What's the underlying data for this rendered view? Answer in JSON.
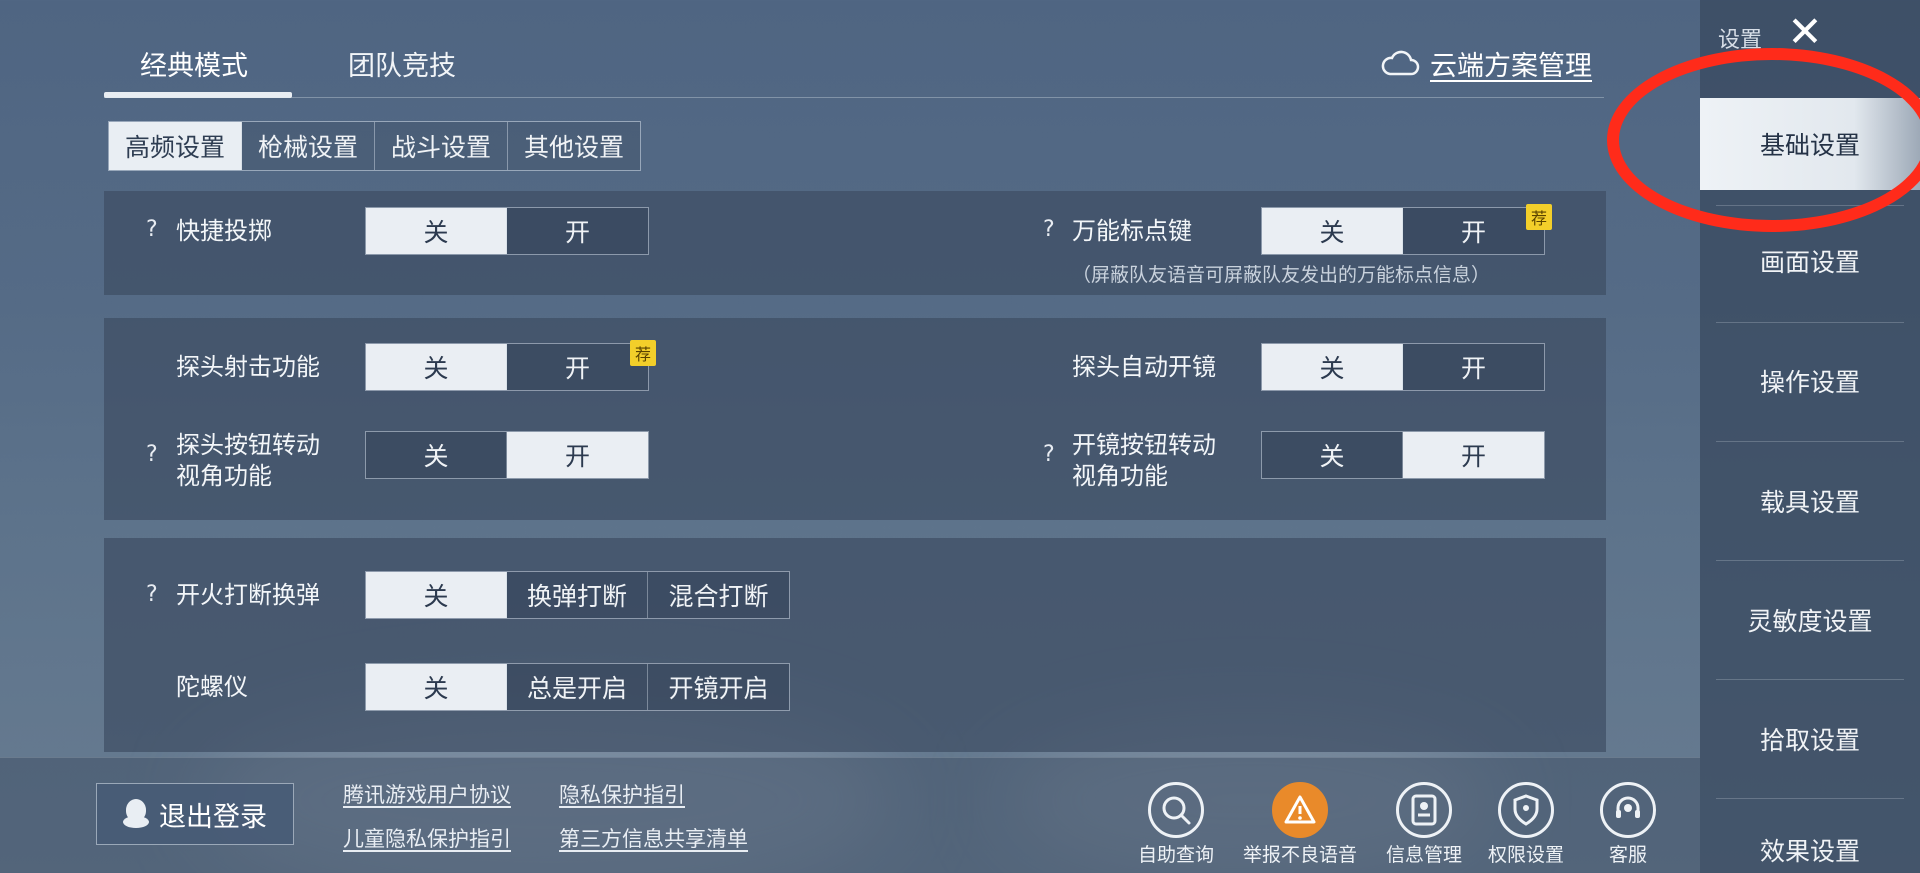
{
  "top_tabs": [
    "经典模式",
    "团队竞技"
  ],
  "cloud": {
    "label": "云端方案管理"
  },
  "sub_tabs": [
    "高频设置",
    "枪械设置",
    "战斗设置",
    "其他设置"
  ],
  "rec_badge": "荐",
  "settings": {
    "quick_throw": {
      "label": "快捷投掷",
      "options": [
        "关",
        "开"
      ],
      "selected": "关"
    },
    "universal_mark": {
      "label": "万能标点键",
      "options": [
        "关",
        "开"
      ],
      "selected": "关",
      "note": "（屏蔽队友语音可屏蔽队友发出的万能标点信息）"
    },
    "peek_shoot": {
      "label": "探头射击功能",
      "options": [
        "关",
        "开"
      ],
      "selected": "关"
    },
    "peek_auto_scope": {
      "label": "探头自动开镜",
      "options": [
        "关",
        "开"
      ],
      "selected": "关"
    },
    "peek_btn_rotate": {
      "label_line1": "探头按钮转动",
      "label_line2": "视角功能",
      "options": [
        "关",
        "开"
      ],
      "selected": "开"
    },
    "scope_btn_rotate": {
      "label_line1": "开镜按钮转动",
      "label_line2": "视角功能",
      "options": [
        "关",
        "开"
      ],
      "selected": "开"
    },
    "fire_interrupt": {
      "label": "开火打断换弹",
      "options": [
        "关",
        "换弹打断",
        "混合打断"
      ],
      "selected": "关"
    },
    "gyro": {
      "label": "陀螺仪",
      "options": [
        "关",
        "总是开启",
        "开镜开启"
      ],
      "selected": "关"
    }
  },
  "help_mark": "?",
  "sidebar": {
    "title": "设置",
    "close": "✕",
    "items": [
      "基础设置",
      "画面设置",
      "操作设置",
      "载具设置",
      "灵敏度设置",
      "拾取设置",
      "效果设置"
    ],
    "active": "基础设置"
  },
  "bottom": {
    "logout": "退出登录",
    "links": [
      "腾讯游戏用户协议",
      "隐私保护指引",
      "儿童隐私保护指引",
      "第三方信息共享清单"
    ],
    "icons": [
      {
        "label": "自助查询",
        "icon": "search-icon"
      },
      {
        "label": "举报不良语音",
        "icon": "warning-icon"
      },
      {
        "label": "信息管理",
        "icon": "id-card-icon"
      },
      {
        "label": "权限设置",
        "icon": "shield-icon"
      },
      {
        "label": "客服",
        "icon": "headset-icon"
      }
    ]
  }
}
